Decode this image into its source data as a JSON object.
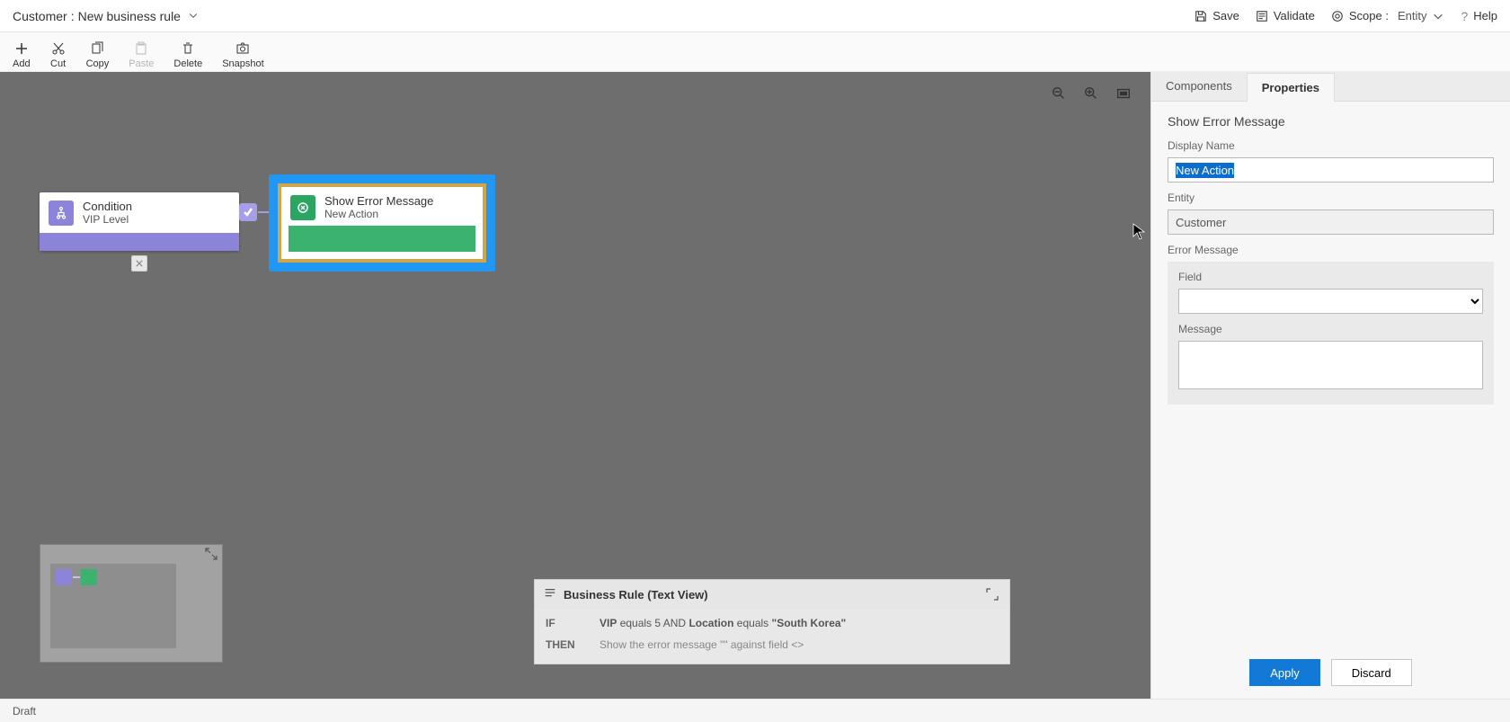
{
  "title": {
    "entity_label": "Customer",
    "rule_name": "New business rule"
  },
  "commands": {
    "save": "Save",
    "validate": "Validate",
    "scope_label": "Scope :",
    "scope_value": "Entity",
    "help": "Help"
  },
  "toolbar": {
    "add": "Add",
    "cut": "Cut",
    "copy": "Copy",
    "paste": "Paste",
    "delete": "Delete",
    "snapshot": "Snapshot"
  },
  "canvas": {
    "condition": {
      "title": "Condition",
      "subtitle": "VIP Level"
    },
    "action": {
      "title": "Show Error Message",
      "subtitle": "New Action"
    }
  },
  "textview": {
    "title": "Business Rule (Text View)",
    "if": "IF",
    "then": "THEN",
    "cond_field1": "VIP",
    "cond_eq": "equals",
    "cond_val1": "5",
    "cond_and": "AND",
    "cond_field2": "Location",
    "cond_val2": "\"South Korea\"",
    "then_text": "Show the error message \"\" against field <>"
  },
  "tabs": {
    "components": "Components",
    "properties": "Properties"
  },
  "properties": {
    "section": "Show Error Message",
    "display_name_label": "Display Name",
    "display_name_value": "New Action",
    "entity_label": "Entity",
    "entity_value": "Customer",
    "error_message_label": "Error Message",
    "field_label": "Field",
    "field_value": "",
    "message_label": "Message",
    "message_value": ""
  },
  "buttons": {
    "apply": "Apply",
    "discard": "Discard"
  },
  "status": "Draft"
}
